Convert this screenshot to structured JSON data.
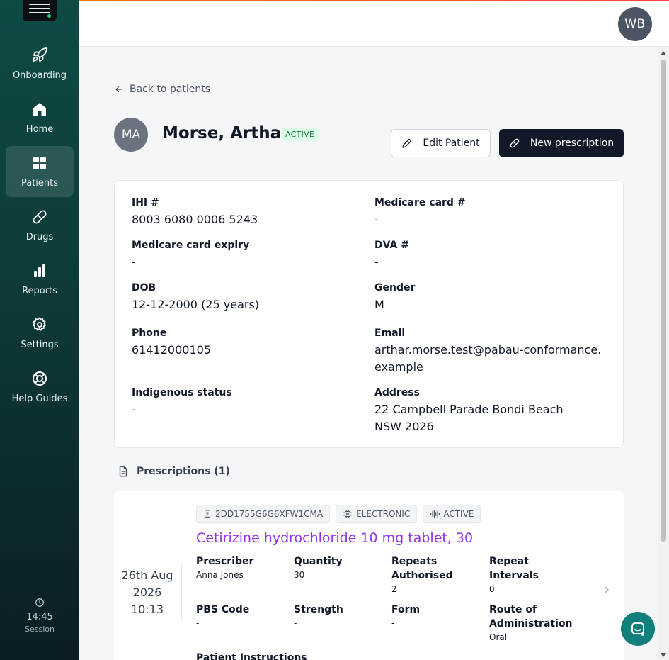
{
  "sidebar": {
    "items": [
      {
        "label": "Onboarding",
        "icon": "rocket-icon"
      },
      {
        "label": "Home",
        "icon": "home-icon"
      },
      {
        "label": "Patients",
        "icon": "grid-icon"
      },
      {
        "label": "Drugs",
        "icon": "pill-icon"
      },
      {
        "label": "Reports",
        "icon": "bar-chart-icon"
      },
      {
        "label": "Settings",
        "icon": "gear-icon"
      },
      {
        "label": "Help Guides",
        "icon": "lifebuoy-icon"
      }
    ],
    "active_item": "Patients",
    "session": {
      "time": "14:45",
      "label": "Session"
    }
  },
  "header": {
    "user_initials": "WB"
  },
  "back_link": "Back to patients",
  "patient": {
    "initials": "MA",
    "name": "Morse, Arthar",
    "status": "ACTIVE"
  },
  "actions": {
    "edit": "Edit Patient",
    "new_prescription": "New prescription"
  },
  "details": {
    "ihi": {
      "label": "IHI #",
      "value": "8003 6080 0006 5243"
    },
    "medicare": {
      "label": "Medicare card #",
      "value": "-"
    },
    "medicare_expiry": {
      "label": "Medicare card expiry",
      "value": "-"
    },
    "dva": {
      "label": "DVA #",
      "value": "-"
    },
    "dob": {
      "label": "DOB",
      "value": "12-12-2000 (25 years)"
    },
    "gender": {
      "label": "Gender",
      "value": "M"
    },
    "phone": {
      "label": "Phone",
      "value": "61412000105"
    },
    "email": {
      "label": "Email",
      "value": "arthar.morse.test@pabau-conformance.example"
    },
    "indigenous": {
      "label": "Indigenous status",
      "value": "-"
    },
    "address": {
      "label": "Address",
      "value": "22 Campbell Parade Bondi Beach NSW 2026"
    }
  },
  "prescriptions": {
    "heading": "Prescriptions (1)",
    "items": [
      {
        "date_line1": "26th Aug",
        "date_line2": "2026",
        "time": "10:13",
        "tags": {
          "id": "2DD1755G6G6XFW1CMA",
          "type": "ELECTRONIC",
          "status": "ACTIVE"
        },
        "title": "Cetirizine hydrochloride 10 mg tablet, 30",
        "fields": {
          "prescriber": {
            "label": "Prescriber",
            "value": "Anna Jones"
          },
          "quantity": {
            "label": "Quantity",
            "value": "30"
          },
          "repeats": {
            "label": "Repeats Authorised",
            "value": "2"
          },
          "intervals": {
            "label": "Repeat Intervals",
            "value": "0"
          },
          "pbs": {
            "label": "PBS Code",
            "value": "-"
          },
          "strength": {
            "label": "Strength",
            "value": "-"
          },
          "form": {
            "label": "Form",
            "value": "-"
          },
          "route": {
            "label": "Route of Administration",
            "value": "Oral"
          },
          "instructions": {
            "label": "Patient Instructions"
          }
        }
      }
    ]
  },
  "colors": {
    "accent_purple": "#9333ea",
    "primary_dark": "#111827",
    "sidebar": "#0f4a45",
    "active_green": "#15803d",
    "chat": "#12807a"
  }
}
